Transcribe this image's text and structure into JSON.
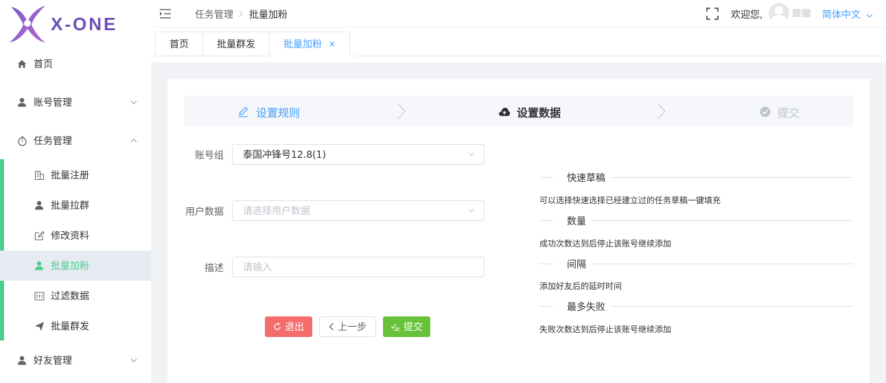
{
  "brand": {
    "logo_text": "X-ONE",
    "accent": "#4ccf8e",
    "primary": "#409eff"
  },
  "sidebar": {
    "items": [
      {
        "label": "首页",
        "icon": "home-icon"
      },
      {
        "label": "账号管理",
        "icon": "user-icon"
      },
      {
        "label": "任务管理",
        "icon": "timer-icon"
      }
    ],
    "sub_items": [
      {
        "label": "批量注册",
        "icon": "building-icon"
      },
      {
        "label": "批量拉群",
        "icon": "user-icon"
      },
      {
        "label": "修改资料",
        "icon": "edit-icon"
      },
      {
        "label": "批量加粉",
        "icon": "user-icon"
      },
      {
        "label": "过滤数据",
        "icon": "filter-data-icon"
      },
      {
        "label": "批量群发",
        "icon": "send-icon"
      }
    ],
    "friend_mgmt": {
      "label": "好友管理",
      "icon": "user-icon"
    }
  },
  "header": {
    "breadcrumb": [
      "任务管理",
      "批量加粉"
    ],
    "welcome": "欢迎您,",
    "language": "简体中文"
  },
  "tabs": [
    {
      "label": "首页"
    },
    {
      "label": "批量群发"
    },
    {
      "label": "批量加粉",
      "close": "×"
    }
  ],
  "steps": [
    {
      "label": "设置规则",
      "status": "done"
    },
    {
      "label": "设置数据",
      "status": "active"
    },
    {
      "label": "提交",
      "status": "wait"
    }
  ],
  "form": {
    "account_group": {
      "label": "账号组",
      "value": "泰国冲锋号12.8(1)"
    },
    "user_data": {
      "label": "用户数据",
      "placeholder": "请选择用户数据"
    },
    "description": {
      "label": "描述",
      "placeholder": "请输入"
    }
  },
  "buttons": {
    "exit": "退出",
    "prev": "上一步",
    "submit": "提交"
  },
  "help": [
    {
      "title": "快速草稿",
      "text": "可以选择快速选择已经建立过的任务草稿一键填充"
    },
    {
      "title": "数量",
      "text": "成功次数达到后停止该账号继续添加"
    },
    {
      "title": "间隔",
      "text": "添加好友后的延时时间"
    },
    {
      "title": "最多失败",
      "text": "失败次数达到后停止该账号继续添加"
    }
  ]
}
